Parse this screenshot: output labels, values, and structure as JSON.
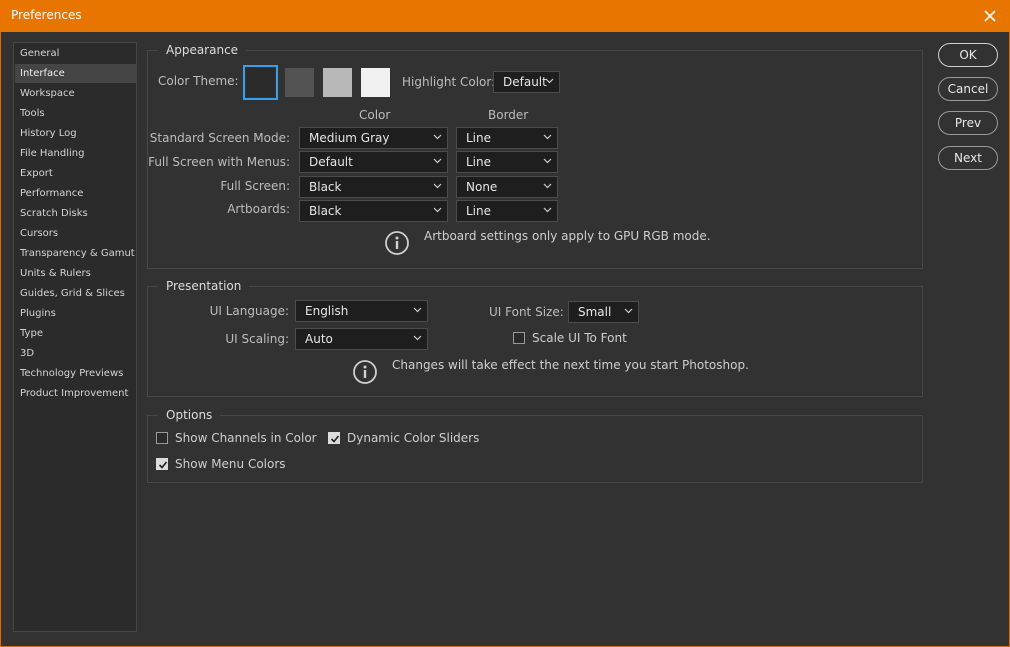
{
  "window": {
    "title": "Preferences"
  },
  "sidebar": {
    "items": [
      {
        "label": "General"
      },
      {
        "label": "Interface"
      },
      {
        "label": "Workspace"
      },
      {
        "label": "Tools"
      },
      {
        "label": "History Log"
      },
      {
        "label": "File Handling"
      },
      {
        "label": "Export"
      },
      {
        "label": "Performance"
      },
      {
        "label": "Scratch Disks"
      },
      {
        "label": "Cursors"
      },
      {
        "label": "Transparency & Gamut"
      },
      {
        "label": "Units & Rulers"
      },
      {
        "label": "Guides, Grid & Slices"
      },
      {
        "label": "Plugins"
      },
      {
        "label": "Type"
      },
      {
        "label": "3D"
      },
      {
        "label": "Technology Previews"
      },
      {
        "label": "Product Improvement"
      }
    ],
    "active": "Interface"
  },
  "appearance": {
    "title": "Appearance",
    "color_theme_label": "Color Theme:",
    "themes": [
      "#2b2b2b",
      "#535353",
      "#b8b8b8",
      "#f0f0f0"
    ],
    "highlight_label": "Highlight Color:",
    "highlight_value": "Default",
    "col_color": "Color",
    "col_border": "Border",
    "rows": [
      {
        "label": "Standard Screen Mode:",
        "color": "Medium Gray",
        "border": "Line"
      },
      {
        "label": "Full Screen with Menus:",
        "color": "Default",
        "border": "Line"
      },
      {
        "label": "Full Screen:",
        "color": "Black",
        "border": "None"
      },
      {
        "label": "Artboards:",
        "color": "Black",
        "border": "Line"
      }
    ],
    "note": "Artboard settings only apply to GPU RGB mode."
  },
  "presentation": {
    "title": "Presentation",
    "language_label": "UI Language:",
    "language_value": "English",
    "font_size_label": "UI Font Size:",
    "font_size_value": "Small",
    "scaling_label": "UI Scaling:",
    "scaling_value": "Auto",
    "scale_to_font_label": "Scale UI To Font",
    "note": "Changes will take effect the next time you start Photoshop."
  },
  "options": {
    "title": "Options",
    "show_channels": "Show Channels in Color",
    "dynamic_sliders": "Dynamic Color Sliders",
    "show_menu_colors": "Show Menu Colors"
  },
  "buttons": {
    "ok": "OK",
    "cancel": "Cancel",
    "prev": "Prev",
    "next": "Next"
  },
  "colors": {
    "titlebar": "#e87500",
    "selection": "#3a9fe8",
    "panel": "#323232"
  }
}
